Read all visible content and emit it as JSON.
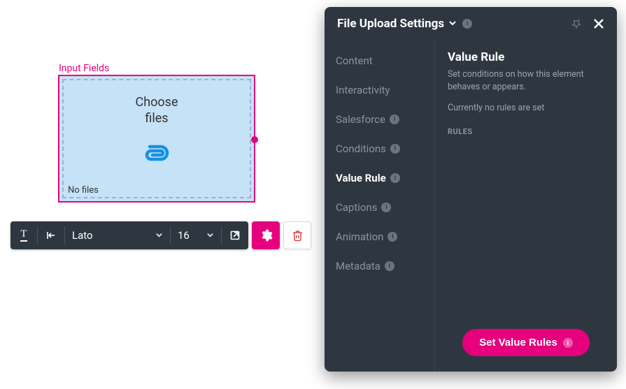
{
  "canvas": {
    "label": "Input Fields",
    "choose_line1": "Choose",
    "choose_line2": "files",
    "no_files": "No files"
  },
  "toolbar": {
    "font_family": "Lato",
    "font_size": "16"
  },
  "panel": {
    "title": "File Upload Settings",
    "tabs": {
      "content": "Content",
      "interactivity": "Interactivity",
      "salesforce": "Salesforce",
      "conditions": "Conditions",
      "value_rule": "Value Rule",
      "captions": "Captions",
      "animation": "Animation",
      "metadata": "Metadata"
    },
    "content": {
      "heading": "Value Rule",
      "description": "Set conditions on how this element behaves or appears.",
      "current_status": "Currently no rules are set",
      "rules_label": "RULES",
      "button_label": "Set Value Rules"
    }
  },
  "colors": {
    "accent": "#e6007e",
    "panel_bg": "#2e3740",
    "widget_bg": "#c6e2f7",
    "icon_blue": "#1491e6"
  }
}
